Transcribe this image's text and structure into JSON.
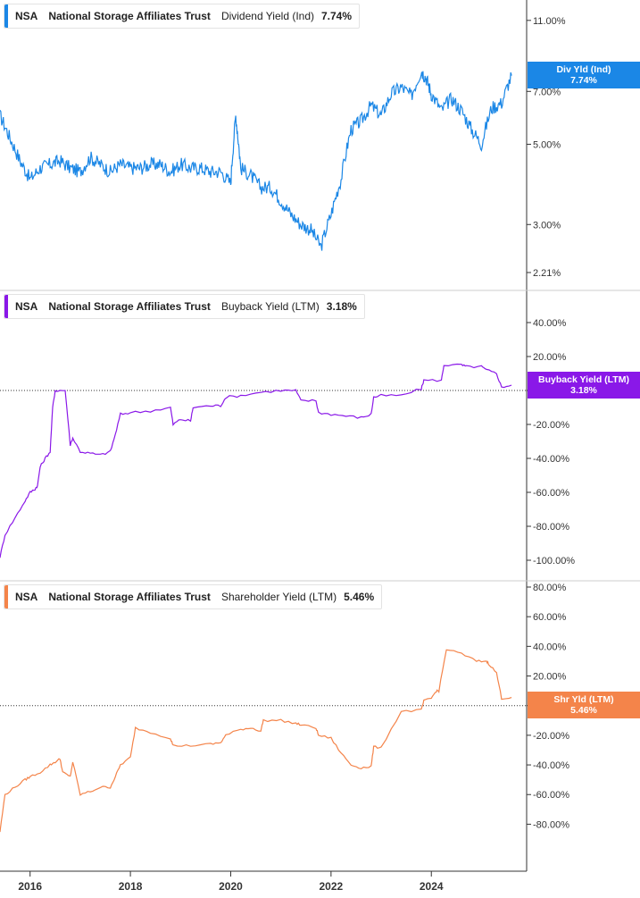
{
  "colors": {
    "dividend": "#1b87e6",
    "buyback": "#8a18e8",
    "shareholder": "#f4844a",
    "axis": "#333333",
    "grid": "#cccccc"
  },
  "panels": [
    {
      "ticker": "NSA",
      "company": "National Storage Affiliates Trust",
      "metric": "Dividend Yield (Ind)",
      "value": "7.74%",
      "tag_line1": "Div Yld (Ind)",
      "tag_line2": "7.74%"
    },
    {
      "ticker": "NSA",
      "company": "National Storage Affiliates Trust",
      "metric": "Buyback Yield (LTM)",
      "value": "3.18%",
      "tag_line1": "Buyback Yield (LTM)",
      "tag_line2": "3.18%"
    },
    {
      "ticker": "NSA",
      "company": "National Storage Affiliates Trust",
      "metric": "Shareholder Yield (LTM)",
      "value": "5.46%",
      "tag_line1": "Shr Yld (LTM)",
      "tag_line2": "5.46%"
    }
  ],
  "chart_data": [
    {
      "type": "line",
      "series": [
        {
          "name": "Dividend Yield (Ind)",
          "x": [
            2015.4,
            2015.6,
            2015.8,
            2016.0,
            2016.2,
            2016.4,
            2016.6,
            2016.8,
            2017.0,
            2017.2,
            2017.4,
            2017.6,
            2017.8,
            2018.0,
            2018.2,
            2018.4,
            2018.6,
            2018.8,
            2019.0,
            2019.2,
            2019.4,
            2019.6,
            2019.8,
            2020.0,
            2020.1,
            2020.2,
            2020.4,
            2020.6,
            2020.8,
            2021.0,
            2021.2,
            2021.4,
            2021.6,
            2021.8,
            2022.0,
            2022.2,
            2022.4,
            2022.6,
            2022.8,
            2023.0,
            2023.2,
            2023.4,
            2023.6,
            2023.8,
            2023.9,
            2024.0,
            2024.2,
            2024.4,
            2024.6,
            2024.8,
            2025.0,
            2025.2,
            2025.4,
            2025.6
          ],
          "y": [
            6.0,
            5.2,
            4.5,
            4.0,
            4.3,
            4.4,
            4.5,
            4.3,
            4.2,
            4.6,
            4.4,
            4.2,
            4.4,
            4.3,
            4.3,
            4.4,
            4.4,
            4.2,
            4.4,
            4.3,
            4.3,
            4.2,
            4.2,
            3.9,
            6.0,
            4.3,
            4.1,
            3.8,
            3.8,
            3.5,
            3.2,
            3.0,
            2.9,
            2.6,
            3.2,
            4.0,
            5.5,
            5.8,
            6.4,
            6.0,
            6.9,
            7.2,
            6.8,
            8.0,
            7.6,
            6.9,
            6.2,
            6.7,
            6.2,
            5.5,
            5.0,
            6.3,
            6.5,
            7.74
          ]
        }
      ],
      "yticks": [
        "11.00%",
        "7.00%",
        "5.00%",
        "3.00%",
        "2.21%"
      ],
      "yscale": "log"
    },
    {
      "type": "line",
      "series": [
        {
          "name": "Buyback Yield (LTM)",
          "x": [
            2015.4,
            2015.5,
            2015.7,
            2015.9,
            2016.0,
            2016.1,
            2016.15,
            2016.2,
            2016.3,
            2016.4,
            2016.45,
            2016.5,
            2016.7,
            2016.8,
            2016.85,
            2017.0,
            2017.2,
            2017.4,
            2017.6,
            2017.7,
            2017.8,
            2018.0,
            2018.4,
            2018.8,
            2018.85,
            2019.0,
            2019.2,
            2019.25,
            2019.6,
            2019.8,
            2019.9,
            2020.2,
            2020.6,
            2021.0,
            2021.3,
            2021.4,
            2021.7,
            2021.75,
            2022.0,
            2022.3,
            2022.6,
            2022.8,
            2022.85,
            2023.0,
            2023.4,
            2023.8,
            2023.85,
            2024.2,
            2024.25,
            2024.6,
            2024.7,
            2025.0,
            2025.1,
            2025.3,
            2025.4,
            2025.6
          ],
          "y": [
            -98,
            -85,
            -75,
            -65,
            -60,
            -58,
            -56,
            -45,
            -40,
            -36,
            -10,
            0,
            0,
            -32,
            -28,
            -36,
            -37,
            -38,
            -36,
            -26,
            -14,
            -13,
            -12,
            -10,
            -20,
            -17,
            -18,
            -10,
            -9,
            -9,
            -4,
            -3,
            -1,
            0,
            0,
            -6,
            -6,
            -13,
            -14,
            -15,
            -16,
            -14,
            -4,
            -3,
            -3,
            1,
            6,
            6,
            15,
            15,
            14,
            14,
            12,
            10,
            2,
            3.18
          ]
        }
      ],
      "yticks": [
        "40.00%",
        "20.00%",
        "0.00%",
        "-20.00%",
        "-40.00%",
        "-60.00%",
        "-80.00%",
        "-100.00%"
      ],
      "ylim": [
        -100,
        40
      ]
    },
    {
      "type": "line",
      "series": [
        {
          "name": "Shareholder Yield (LTM)",
          "x": [
            2015.4,
            2015.5,
            2015.7,
            2015.9,
            2016.0,
            2016.2,
            2016.4,
            2016.5,
            2016.6,
            2016.65,
            2016.8,
            2016.85,
            2017.0,
            2017.2,
            2017.4,
            2017.6,
            2017.7,
            2017.8,
            2018.0,
            2018.1,
            2018.4,
            2018.8,
            2018.85,
            2019.2,
            2019.6,
            2019.8,
            2019.9,
            2020.2,
            2020.4,
            2020.6,
            2020.65,
            2021.0,
            2021.3,
            2021.4,
            2021.7,
            2021.75,
            2022.0,
            2022.2,
            2022.4,
            2022.6,
            2022.8,
            2022.85,
            2023.0,
            2023.4,
            2023.8,
            2023.85,
            2024.0,
            2024.1,
            2024.15,
            2024.3,
            2024.6,
            2024.9,
            2025.1,
            2025.15,
            2025.3,
            2025.4,
            2025.6
          ],
          "y": [
            -85,
            -60,
            -55,
            -50,
            -48,
            -45,
            -40,
            -38,
            -36,
            -45,
            -48,
            -38,
            -60,
            -58,
            -55,
            -55,
            -48,
            -40,
            -35,
            -15,
            -18,
            -22,
            -27,
            -27,
            -26,
            -25,
            -20,
            -16,
            -15,
            -17,
            -10,
            -10,
            -12,
            -13,
            -15,
            -20,
            -22,
            -32,
            -40,
            -42,
            -41,
            -28,
            -28,
            -4,
            -3,
            3,
            5,
            10,
            10,
            38,
            35,
            30,
            30,
            28,
            22,
            5,
            5.46
          ]
        }
      ],
      "yticks": [
        "80.00%",
        "60.00%",
        "40.00%",
        "20.00%",
        "0.00%",
        "-20.00%",
        "-40.00%",
        "-60.00%",
        "-80.00%"
      ],
      "ylim": [
        -90,
        80
      ]
    }
  ],
  "xaxis": {
    "ticks": [
      "2016",
      "2018",
      "2020",
      "2022",
      "2024"
    ],
    "range": [
      2015.4,
      2025.9
    ]
  }
}
